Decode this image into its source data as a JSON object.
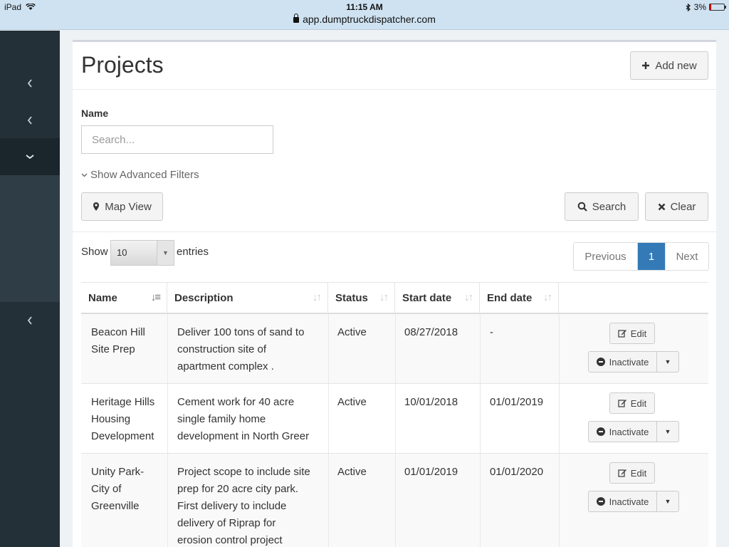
{
  "statusbar": {
    "device": "iPad",
    "time": "11:15 AM",
    "url": "app.dumptruckdispatcher.com",
    "battery": "3%",
    "icons": [
      "wifi-icon",
      "bluetooth-icon",
      "battery-icon",
      "lock-icon"
    ]
  },
  "sidebar": {
    "items": [
      {
        "icon": "chevron-left-icon",
        "glyph": "‹"
      },
      {
        "icon": "chevron-left-icon",
        "glyph": "‹"
      },
      {
        "icon": "chevron-down-icon",
        "glyph": "⌄"
      },
      {
        "icon": "chevron-left-icon",
        "glyph": "‹"
      }
    ]
  },
  "page": {
    "title": "Projects",
    "add_new_label": "Add new"
  },
  "filters": {
    "name_label": "Name",
    "search_placeholder": "Search...",
    "search_value": "",
    "advanced_label": "Show Advanced Filters",
    "map_view_label": "Map View",
    "search_label": "Search",
    "clear_label": "Clear"
  },
  "listing": {
    "show_label": "Show",
    "entries_value": "10",
    "entries_label": "entries"
  },
  "pagination": {
    "previous_label": "Previous",
    "current_page": "1",
    "next_label": "Next"
  },
  "table": {
    "columns": [
      "Name",
      "Description",
      "Status",
      "Start date",
      "End date",
      ""
    ],
    "rows": [
      {
        "name": [
          "Beacon Hill",
          "Site Prep"
        ],
        "description": [
          "Deliver 100 tons of sand to",
          "construction site of",
          "apartment complex ."
        ],
        "status": "Active",
        "start_date": "08/27/2018",
        "end_date": "-",
        "edit_label": "Edit",
        "inactivate_label": "Inactivate"
      },
      {
        "name": [
          "Heritage Hills",
          "Housing",
          "Development"
        ],
        "description": [
          "Cement work for 40 acre",
          "single family home",
          "development in North Greer"
        ],
        "status": "Active",
        "start_date": "10/01/2018",
        "end_date": "01/01/2019",
        "edit_label": "Edit",
        "inactivate_label": "Inactivate"
      },
      {
        "name": [
          "Unity Park-",
          "City of",
          "Greenville"
        ],
        "description": [
          "Project scope to include site",
          "prep for 20 acre city park.",
          "First delivery to include",
          "delivery of Riprap for",
          "erosion control project"
        ],
        "status": "Active",
        "start_date": "01/01/2019",
        "end_date": "01/01/2020",
        "edit_label": "Edit",
        "inactivate_label": "Inactivate"
      }
    ]
  }
}
